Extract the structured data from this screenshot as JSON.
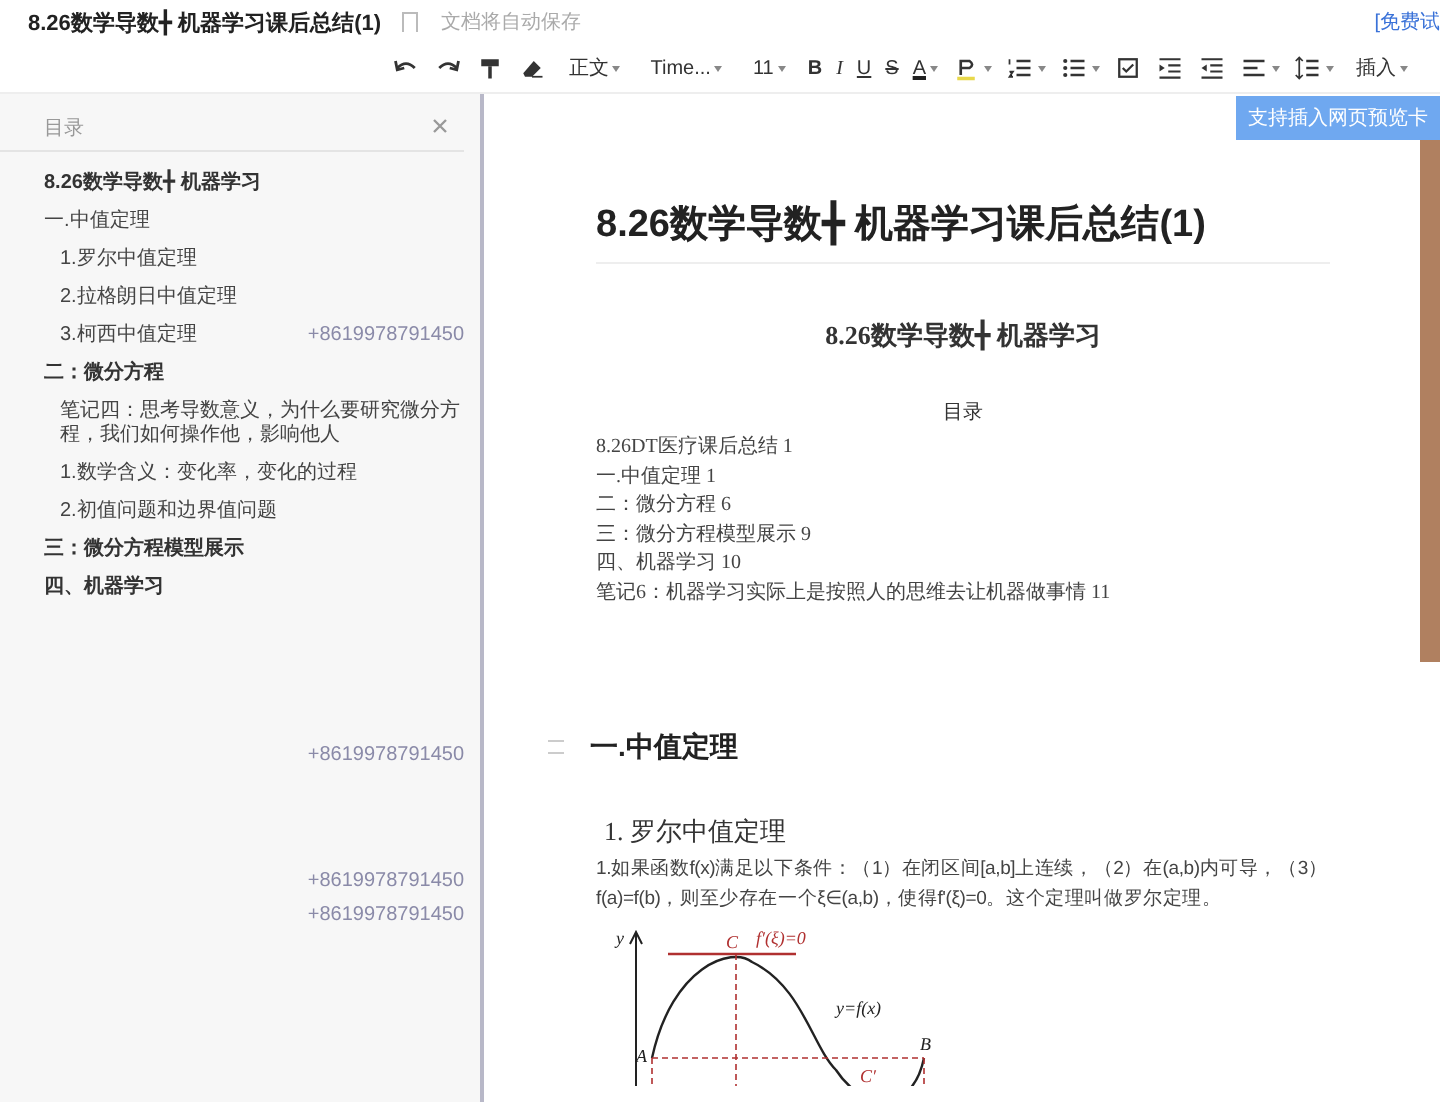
{
  "header": {
    "title": "8.26数学导数╋ 机器学习课后总结(1)",
    "save_status": "文档将自动保存",
    "trial_link": "[免费试"
  },
  "toolbar": {
    "items": [
      {
        "kind": "undo"
      },
      {
        "kind": "redo"
      },
      {
        "kind": "painter"
      },
      {
        "kind": "eraser"
      },
      {
        "kind": "dropdown",
        "label": "正文"
      },
      {
        "kind": "dropdown",
        "label": "Time..."
      },
      {
        "kind": "dropdown",
        "label": "11"
      },
      {
        "kind": "bold",
        "label": "B"
      },
      {
        "kind": "italic",
        "label": "I"
      },
      {
        "kind": "underline",
        "label": "U"
      },
      {
        "kind": "strike",
        "label": "S"
      },
      {
        "kind": "fontcolor",
        "label": "A"
      },
      {
        "kind": "highlighter"
      },
      {
        "kind": "numbered"
      },
      {
        "kind": "bullets"
      },
      {
        "kind": "checklist"
      },
      {
        "kind": "indent"
      },
      {
        "kind": "outdent"
      },
      {
        "kind": "align"
      },
      {
        "kind": "spacing"
      },
      {
        "kind": "dropdown",
        "label": "插入"
      }
    ],
    "tooltip": "支持插入网页预览卡"
  },
  "outline": {
    "title": "目录",
    "items": [
      {
        "label": "8.26数学导数╋ 机器学习",
        "bold": true
      },
      {
        "label": "一.中值定理",
        "bold": false,
        "children": [
          {
            "label": "1.罗尔中值定理",
            "bold": false
          },
          {
            "label": "2.拉格朗日中值定理",
            "bold": false
          },
          {
            "label": "3.柯西中值定理",
            "bold": false,
            "comment": "+8619978791450"
          }
        ]
      },
      {
        "label": "二：微分方程",
        "bold": true,
        "children": [
          {
            "label": "笔记四：思考导数意义，为什么要研究微分方程，我们如何操作他，影响他人",
            "bold": false
          },
          {
            "label": "1.数学含义：变化率，变化的过程",
            "bold": false
          },
          {
            "label": "2.初值问题和边界值问题",
            "bold": false
          }
        ]
      },
      {
        "label": "三：微分方程模型展示",
        "bold": true
      },
      {
        "label": "四、机器学习",
        "bold": true
      }
    ],
    "margin_comments": [
      "+8619978791450",
      "+8619978791450",
      "+8619978791450"
    ]
  },
  "document": {
    "title": "8.26数学导数╋ 机器学习课后总结(1)",
    "subtitle": "8.26数学导数╋ 机器学习",
    "toc_heading": "目录",
    "toc": [
      "8.26DT医疗课后总结 1",
      "一.中值定理 1",
      "二：微分方程 6",
      "三：微分方程模型展示 9",
      "四、机器学习 10",
      "笔记6：机器学习实际上是按照人的思维去让机器做事情 11"
    ],
    "section_heading": "一.中值定理",
    "subheading": "1. 罗尔中值定理",
    "paragraph": "1.如果函数f(x)满足以下条件：（1）在闭区间[a,b]上连续，（2）在(a,b)内可导，（3）f(a)=f(b)，则至少存在一个ξ∈(a,b)，使得f'(ξ)=0。这个定理叫做罗尔定理。",
    "figure_labels": {
      "y_axis": "y",
      "peak": "C",
      "tangent": "f′(ξ)=0",
      "curve": "y=f(x)",
      "left": "A",
      "right": "B",
      "trough": "C′"
    }
  }
}
